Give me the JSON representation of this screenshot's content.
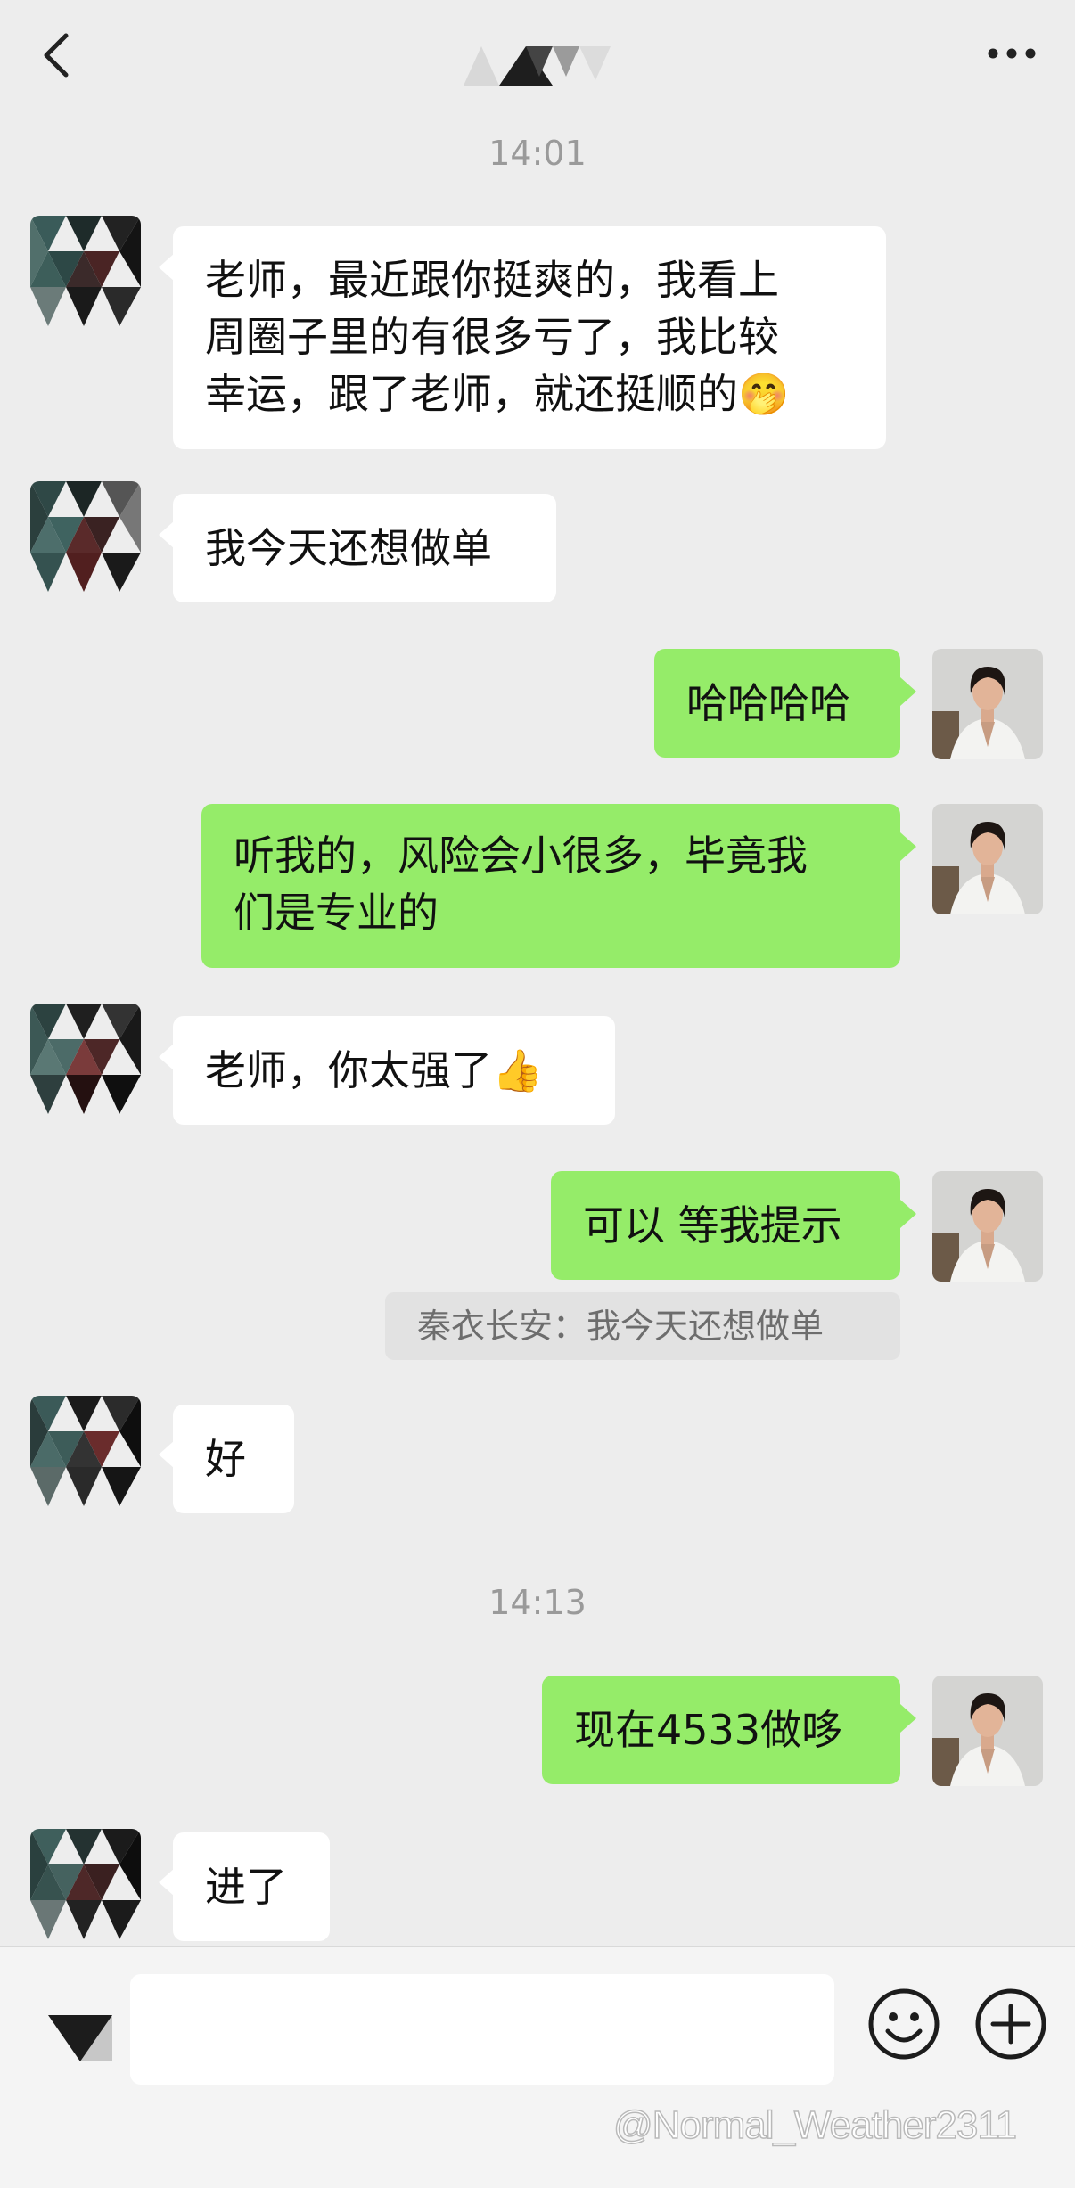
{
  "header": {
    "back_icon": "chevron-left-icon",
    "more_icon": "more-dots-icon"
  },
  "messages": {
    "ts1": "14:01",
    "m1_line1": "老师，最近跟你挺爽的，我看上",
    "m1_line2": "周圈子里的有很多亏了，我比较",
    "m1_line3": "幸运，跟了老师，就还挺顺的",
    "m1_emoji": "🤭",
    "m2": "我今天还想做单",
    "m3": "哈哈哈哈",
    "m4_line1": "听我的，风险会小很多，毕竟我",
    "m4_line2": "们是专业的",
    "m5": "老师，你太强了",
    "m5_emoji": "👍",
    "m6": "可以 等我提示",
    "m6_quote": "秦衣长安：我今天还想做单",
    "m7": "好",
    "ts2": "14:13",
    "m8": "现在4533做哆",
    "m9": "进了"
  },
  "input": {
    "value": "",
    "voice_icon": "voice-toggle-icon",
    "emoji_icon": "emoji-face-icon",
    "plus_icon": "plus-icon"
  },
  "watermark": "@Normal_Weather2311",
  "colors": {
    "background": "#ededed",
    "incoming_bubble": "#ffffff",
    "outgoing_bubble": "#95ec69"
  }
}
